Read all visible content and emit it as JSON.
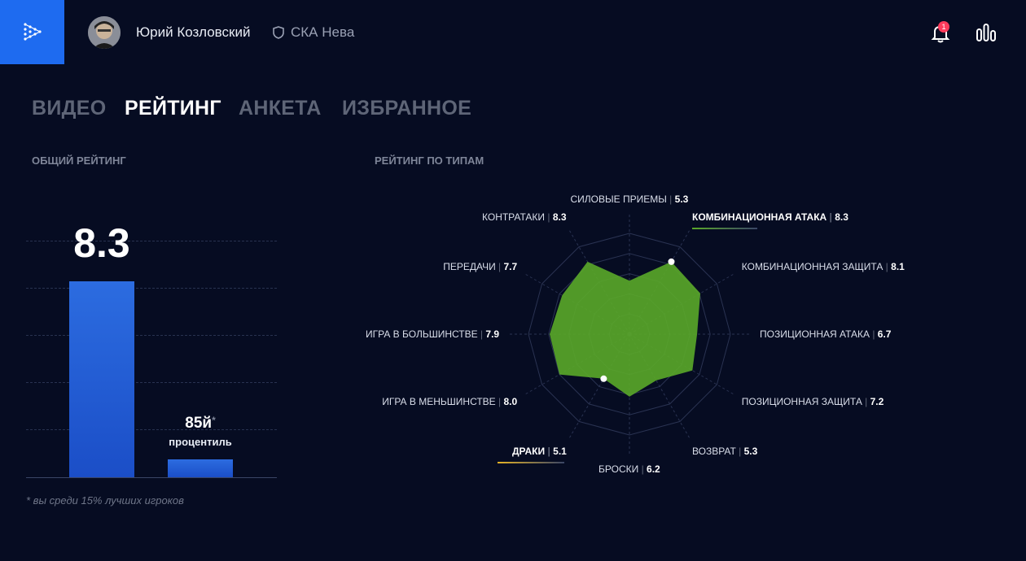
{
  "header": {
    "user_name": "Юрий Козловский",
    "team_name": "СКА Нева",
    "notification_count": "1"
  },
  "tabs": [
    {
      "label": "ВИДЕО",
      "active": false
    },
    {
      "label": "РЕЙТИНГ",
      "active": true
    },
    {
      "label": "АНКЕТА",
      "active": false
    },
    {
      "label": "ИЗБРАННОЕ",
      "active": false
    }
  ],
  "overall": {
    "section_title": "ОБЩИЙ РЕЙТИНГ",
    "rating_value": "8.3",
    "percentile_value": "85й",
    "percentile_asterisk": "*",
    "percentile_label": "процентиль",
    "footnote": "* вы среди 15% лучших игроков"
  },
  "by_type": {
    "section_title": "РЕЙТИНГ ПО ТИПАМ"
  },
  "colors": {
    "accent": "#1e6bf0",
    "radar_fill": "#5aa829",
    "highlight_green": "#5aa829",
    "highlight_yellow": "#e5b326",
    "badge": "#ff3b5c"
  },
  "chart_data": [
    {
      "type": "bar",
      "categories": [
        "рейтинг",
        "процентиль"
      ],
      "values": [
        8.3,
        85
      ],
      "ylim": [
        0,
        10
      ]
    },
    {
      "type": "radar",
      "ylim": [
        0,
        10
      ],
      "axes": [
        {
          "label": "СИЛОВЫЕ ПРИЕМЫ",
          "value": 5.3,
          "value_text": "5.3"
        },
        {
          "label": "КОМБИНАЦИОННАЯ АТАКА",
          "value": 8.3,
          "value_text": "8.3",
          "highlight": "green"
        },
        {
          "label": "КОМБИНАЦИОННАЯ ЗАЩИТА",
          "value": 8.1,
          "value_text": "8.1"
        },
        {
          "label": "ПОЗИЦИОННАЯ АТАКА",
          "value": 6.7,
          "value_text": "6.7"
        },
        {
          "label": "ПОЗИЦИОННАЯ ЗАЩИТА",
          "value": 7.2,
          "value_text": "7.2"
        },
        {
          "label": "ВОЗВРАТ",
          "value": 5.3,
          "value_text": "5.3"
        },
        {
          "label": "БРОСКИ",
          "value": 6.2,
          "value_text": "6.2"
        },
        {
          "label": "ДРАКИ",
          "value": 5.1,
          "value_text": "5.1",
          "highlight": "yellow"
        },
        {
          "label": "ИГРА В МЕНЬШИНСТВЕ",
          "value": 8.0,
          "value_text": "8.0"
        },
        {
          "label": "ИГРА В БОЛЬШИНСТВЕ",
          "value": 7.9,
          "value_text": "7.9"
        },
        {
          "label": "ПЕРЕДАЧИ",
          "value": 7.7,
          "value_text": "7.7"
        },
        {
          "label": "КОНТРАТАКИ",
          "value": 8.3,
          "value_text": "8.3"
        }
      ]
    }
  ]
}
